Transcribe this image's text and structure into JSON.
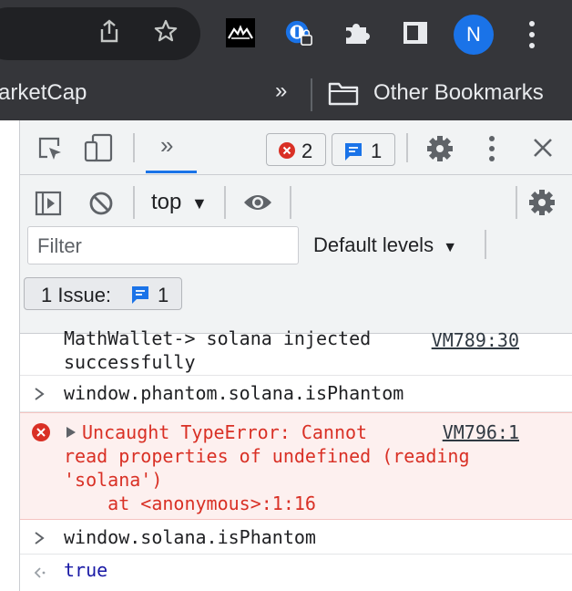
{
  "browser": {
    "bookmark_partial": "arketCap",
    "overflow_chevron": "»",
    "other_bookmarks": "Other Bookmarks",
    "profile_initial": "N"
  },
  "devtools": {
    "more_tabs": "»",
    "error_count": "2",
    "message_count": "1",
    "context": "top",
    "filter_placeholder": "Filter",
    "levels": "Default levels",
    "issues_label": "1 Issue:",
    "issues_count": "1"
  },
  "console": {
    "rows": [
      {
        "type": "log",
        "line1": "MathWallet-> solana injected",
        "line2": "successfully",
        "source": "VM789:30"
      },
      {
        "type": "input",
        "text": "window.phantom.solana.isPhantom"
      },
      {
        "type": "error",
        "line1": "Uncaught TypeError: Cannot",
        "line2": "read properties of undefined (reading",
        "line3": "'solana')",
        "line4": "    at <anonymous>:1:16",
        "source": "VM796:1"
      },
      {
        "type": "input",
        "text": "window.solana.isPhantom"
      },
      {
        "type": "result",
        "text": "true"
      }
    ]
  },
  "colors": {
    "error_red": "#d93025",
    "accent_blue": "#1a73e8",
    "result_blue": "#1a1aa6"
  }
}
